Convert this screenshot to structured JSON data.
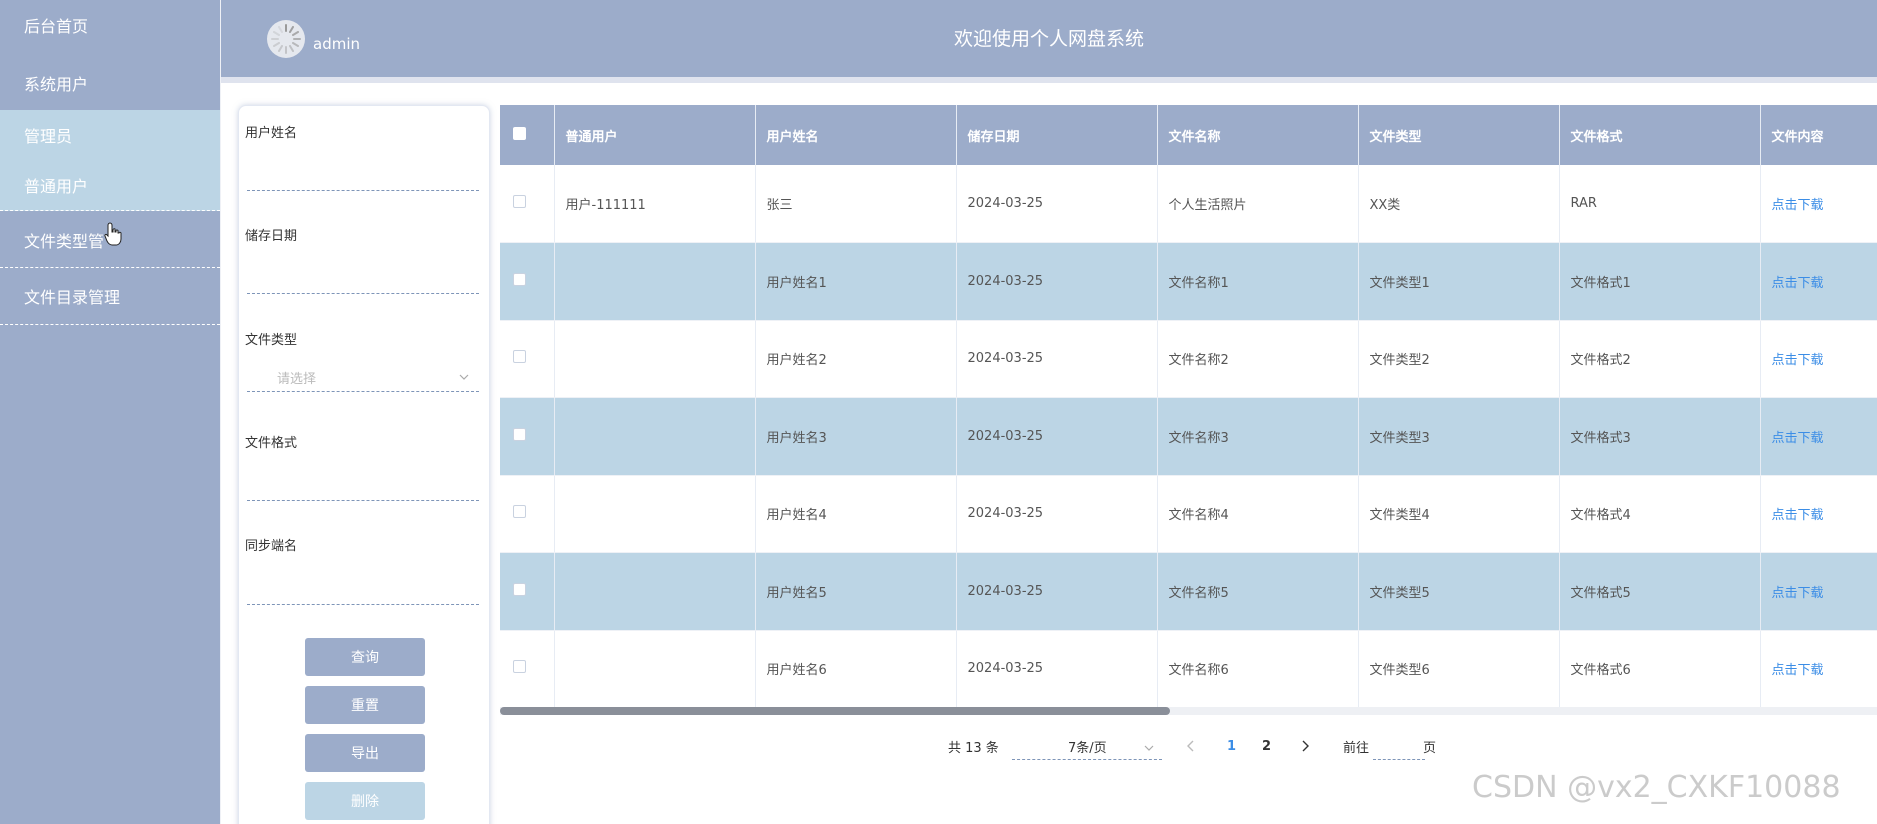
{
  "sidebar": {
    "items": [
      {
        "label": "后台首页"
      },
      {
        "label": "系统用户"
      },
      {
        "label": "管理员"
      },
      {
        "label": "普通用户"
      },
      {
        "label": "文件类型管"
      },
      {
        "label": "文件目录管理"
      }
    ]
  },
  "header": {
    "user": "admin",
    "title": "欢迎使用个人网盘系统"
  },
  "search": {
    "fields": [
      {
        "label": "用户姓名",
        "value": ""
      },
      {
        "label": "储存日期",
        "value": ""
      },
      {
        "label": "文件类型",
        "placeholder": "请选择"
      },
      {
        "label": "文件格式",
        "value": ""
      },
      {
        "label": "同步端名",
        "value": ""
      }
    ],
    "buttons": {
      "query": "查询",
      "reset": "重置",
      "export": "导出",
      "delete": "删除"
    }
  },
  "table": {
    "columns": [
      "普通用户",
      "用户姓名",
      "储存日期",
      "文件名称",
      "文件类型",
      "文件格式",
      "文件内容"
    ],
    "rows": [
      {
        "user": "用户-111111",
        "name": "张三",
        "date": "2024-03-25",
        "fname": "个人生活照片",
        "ftype": "XX类",
        "fformat": "RAR",
        "content": "点击下载"
      },
      {
        "user": "",
        "name": "用户姓名1",
        "date": "2024-03-25",
        "fname": "文件名称1",
        "ftype": "文件类型1",
        "fformat": "文件格式1",
        "content": "点击下载"
      },
      {
        "user": "",
        "name": "用户姓名2",
        "date": "2024-03-25",
        "fname": "文件名称2",
        "ftype": "文件类型2",
        "fformat": "文件格式2",
        "content": "点击下载"
      },
      {
        "user": "",
        "name": "用户姓名3",
        "date": "2024-03-25",
        "fname": "文件名称3",
        "ftype": "文件类型3",
        "fformat": "文件格式3",
        "content": "点击下载"
      },
      {
        "user": "",
        "name": "用户姓名4",
        "date": "2024-03-25",
        "fname": "文件名称4",
        "ftype": "文件类型4",
        "fformat": "文件格式4",
        "content": "点击下载"
      },
      {
        "user": "",
        "name": "用户姓名5",
        "date": "2024-03-25",
        "fname": "文件名称5",
        "ftype": "文件类型5",
        "fformat": "文件格式5",
        "content": "点击下载"
      },
      {
        "user": "",
        "name": "用户姓名6",
        "date": "2024-03-25",
        "fname": "文件名称6",
        "ftype": "文件类型6",
        "fformat": "文件格式6",
        "content": "点击下载"
      }
    ]
  },
  "pagination": {
    "total": "共 13 条",
    "page_size": "7条/页",
    "pages": [
      "1",
      "2"
    ],
    "goto_prefix": "前往",
    "goto_suffix": "页"
  },
  "watermark": "CSDN @vx2_CXKF10088",
  "colors": {
    "primary": "#9cacca",
    "highlight": "#bcd5e5",
    "link": "#3b8de6"
  }
}
